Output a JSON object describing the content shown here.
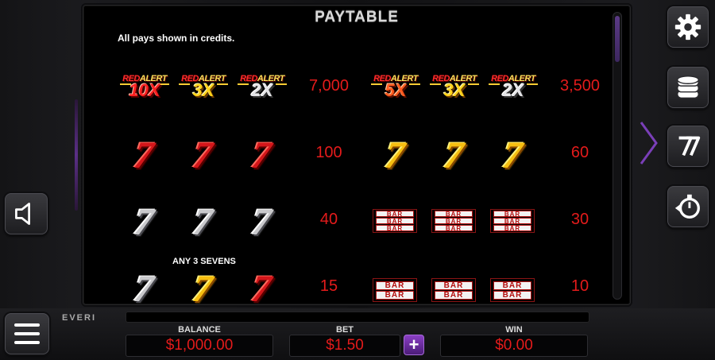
{
  "paytable": {
    "title": "PAYTABLE",
    "note": "All pays shown in credits.",
    "any_three_label": "ANY 3 SEVENS",
    "red_alert_word": "RED",
    "alert_word": "ALERT",
    "bar_word": "BAR",
    "seven_glyph": "7",
    "rows": [
      {
        "left": {
          "symbols": [
            "red-alert-10x",
            "red-alert-3x",
            "red-alert-2x"
          ],
          "mults": [
            "10X",
            "3X",
            "2X"
          ],
          "pay": "7,000"
        },
        "right": {
          "symbols": [
            "red-alert-5x",
            "red-alert-3x",
            "red-alert-2x"
          ],
          "mults": [
            "5X",
            "3X",
            "2X"
          ],
          "pay": "3,500"
        }
      },
      {
        "left": {
          "symbols": [
            "red-seven",
            "red-seven",
            "red-seven"
          ],
          "pay": "100"
        },
        "right": {
          "symbols": [
            "gold-seven",
            "gold-seven",
            "gold-seven"
          ],
          "pay": "60"
        }
      },
      {
        "left": {
          "symbols": [
            "silver-seven",
            "silver-seven",
            "silver-seven"
          ],
          "pay": "40"
        },
        "right": {
          "symbols": [
            "triple-bar",
            "triple-bar",
            "triple-bar"
          ],
          "pay": "30"
        }
      },
      {
        "left": {
          "symbols": [
            "silver-seven",
            "gold-seven",
            "red-seven"
          ],
          "pay": "15"
        },
        "right": {
          "symbols": [
            "double-bar",
            "double-bar",
            "double-bar"
          ],
          "pay": "10"
        }
      }
    ]
  },
  "brand": "EVERI",
  "meters": {
    "balance_label": "BALANCE",
    "balance": "$1,000.00",
    "bet_label": "BET",
    "bet": "$1.50",
    "win_label": "WIN",
    "win": "$0.00"
  },
  "bet_plus": "+",
  "buttons": [
    "settings-gear",
    "stacked-coins",
    "sevens-paytable",
    "replay-history",
    "sound-speaker",
    "menu-hamburger"
  ],
  "colors": {
    "accent": "#6a3aa0",
    "pay_text": "#e41b1b"
  }
}
